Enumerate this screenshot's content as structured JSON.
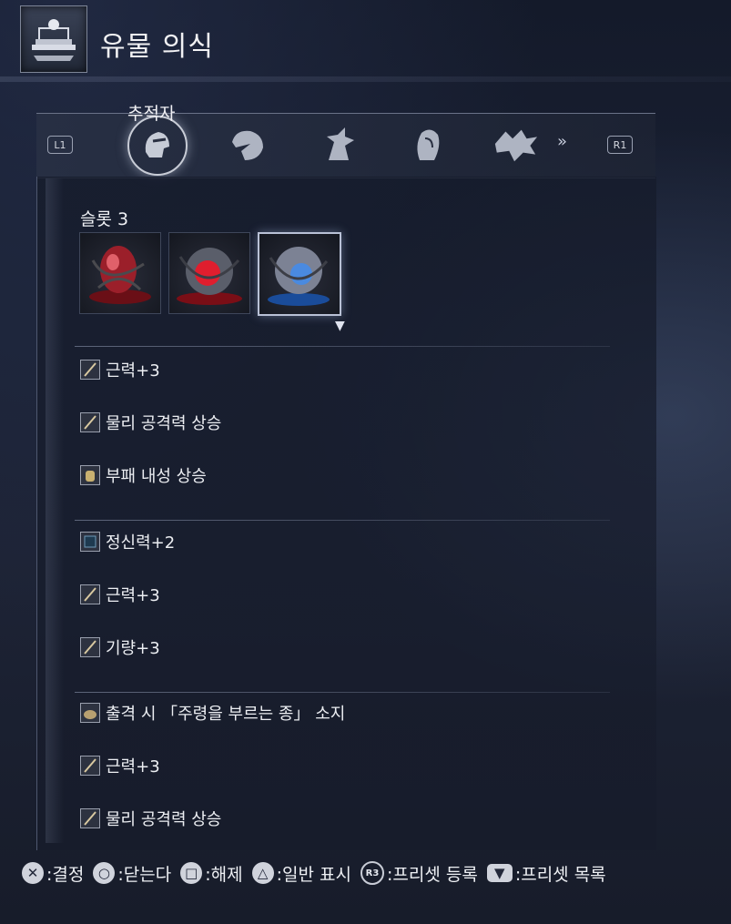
{
  "header": {
    "title": "유물 의식",
    "icon": "relic-altar-icon"
  },
  "tabs": {
    "left_shoulder": "L1",
    "right_shoulder": "R1",
    "active_label": "추적자",
    "items": [
      {
        "icon": "tracker-helm-icon",
        "active": true
      },
      {
        "icon": "eagle-head-icon",
        "active": false
      },
      {
        "icon": "feathered-figure-icon",
        "active": false
      },
      {
        "icon": "hooded-woman-icon",
        "active": false
      },
      {
        "icon": "dragon-head-icon",
        "active": false
      }
    ],
    "more_icon": "double-chevron-right-icon"
  },
  "slot_section": {
    "label": "슬롯 3",
    "slots": [
      {
        "color": "#c0283a",
        "icon": "red-relic-egg-icon",
        "selected": false
      },
      {
        "color": "#d81c2c",
        "icon": "red-relic-orb-icon",
        "selected": false
      },
      {
        "color": "#3a7bd0",
        "icon": "blue-relic-orb-icon",
        "selected": true
      }
    ]
  },
  "effect_groups": [
    {
      "effects": [
        {
          "text": "근력+3",
          "icon": "sword-icon"
        },
        {
          "text": "물리 공격력 상승",
          "icon": "sword-icon"
        },
        {
          "text": "부패 내성 상승",
          "icon": "armor-icon"
        }
      ]
    },
    {
      "effects": [
        {
          "text": "정신력+2",
          "icon": "mind-icon"
        },
        {
          "text": "근력+3",
          "icon": "sword-icon"
        },
        {
          "text": "기량+3",
          "icon": "sword-icon"
        }
      ]
    },
    {
      "effects": [
        {
          "text": "출격 시 「주령을 부르는 종」 소지",
          "icon": "pouch-icon"
        },
        {
          "text": "근력+3",
          "icon": "sword-icon"
        },
        {
          "text": "물리 공격력 상승",
          "icon": "sword-icon"
        }
      ]
    }
  ],
  "footer": [
    {
      "button": "✕",
      "label": ":결정",
      "icon": "cross-button-icon"
    },
    {
      "button": "○",
      "label": ":닫는다",
      "icon": "circle-button-icon"
    },
    {
      "button": "□",
      "label": ":해제",
      "icon": "square-button-icon"
    },
    {
      "button": "△",
      "label": ":일반 표시",
      "icon": "triangle-button-icon"
    },
    {
      "button": "R3",
      "label": ":프리셋 등록",
      "icon": "r3-button-icon"
    },
    {
      "button": "▼",
      "label": ":프리셋 목록",
      "icon": "touchpad-button-icon"
    }
  ]
}
